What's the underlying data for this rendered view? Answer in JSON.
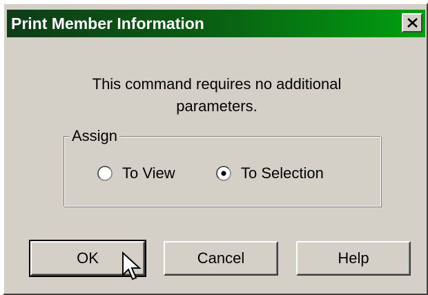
{
  "dialog": {
    "title": "Print Member Information",
    "message_lines": [
      "This command requires no additional",
      "parameters."
    ]
  },
  "assign_group": {
    "label": "Assign",
    "options": [
      {
        "label": "To View",
        "selected": false
      },
      {
        "label": "To Selection",
        "selected": true
      }
    ]
  },
  "buttons": {
    "ok": "OK",
    "cancel": "Cancel",
    "help": "Help"
  },
  "icons": {
    "close": "close-icon",
    "cursor": "mouse-pointer-icon"
  },
  "colors": {
    "face": "#d4d0c8",
    "title_gradient_start": "#0f3d18",
    "title_gradient_end": "#00a010",
    "title_text": "#ffffff"
  }
}
